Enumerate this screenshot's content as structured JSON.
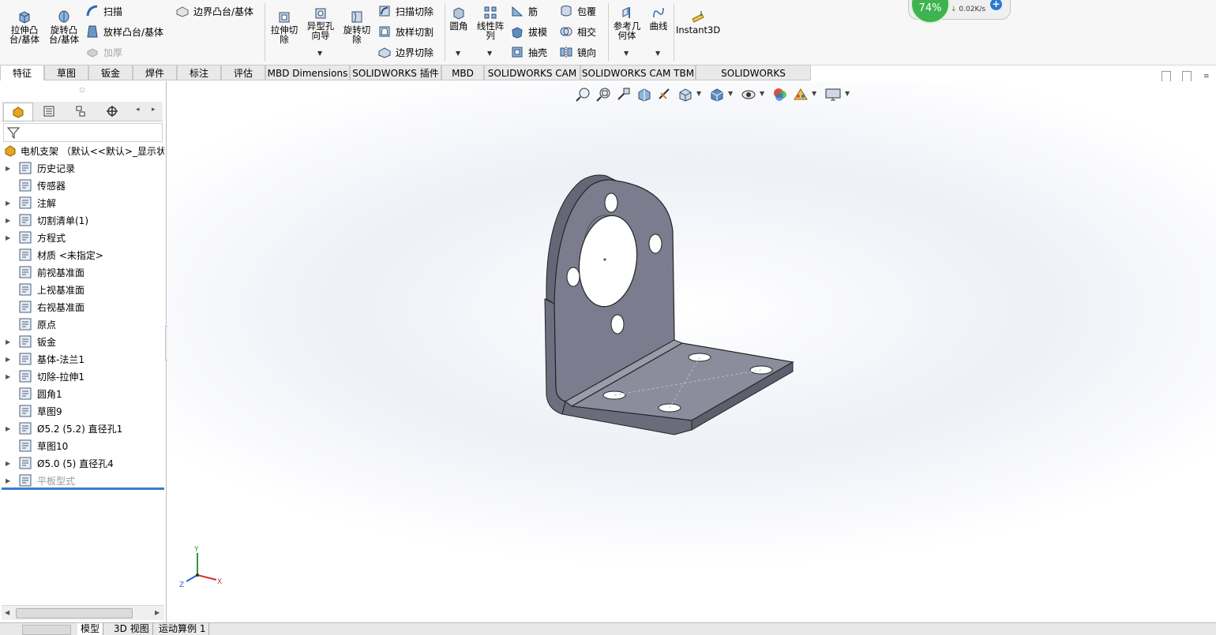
{
  "ribbon": {
    "extrude_boss": "拉伸凸\n台/基体",
    "revolve_boss": "旋转凸\n台/基体",
    "sweep": "扫描",
    "loft_boss": "放样凸台/基体",
    "thicken": "加厚",
    "boundary_boss": "边界凸台/基体",
    "extrude_cut": "拉伸切\n除",
    "hole_wizard": "异型孔\n向导",
    "revolve_cut": "旋转切\n除",
    "swept_cut": "扫描切除",
    "lofted_cut": "放样切割",
    "boundary_cut": "边界切除",
    "fillet": "圆角",
    "linear_pattern": "线性阵\n列",
    "rib": "筋",
    "draft": "拔模",
    "shell": "抽壳",
    "wrap": "包覆",
    "intersect": "相交",
    "mirror": "镜向",
    "ref_geometry": "参考几\n何体",
    "curves": "曲线",
    "instant3d": "Instant3D"
  },
  "perf_widget": {
    "percent": "74%",
    "speed": "0.02K/s"
  },
  "tabs": [
    "特征",
    "草图",
    "钣金",
    "焊件",
    "标注",
    "评估",
    "MBD Dimensions",
    "SOLIDWORKS 插件",
    "MBD",
    "SOLIDWORKS CAM",
    "SOLIDWORKS CAM TBM",
    "SOLIDWORKS Inspection"
  ],
  "tree": {
    "root": "电机支架 （默认<<默认>_显示状态",
    "items": [
      {
        "label": "历史记录",
        "expand": true,
        "icon": "history-icon"
      },
      {
        "label": "传感器",
        "expand": false,
        "icon": "sensor-icon"
      },
      {
        "label": "注解",
        "expand": true,
        "icon": "annotation-icon"
      },
      {
        "label": "切割清单(1)",
        "expand": true,
        "icon": "cut-list-icon"
      },
      {
        "label": "方程式",
        "expand": true,
        "icon": "equation-icon"
      },
      {
        "label": "材质 <未指定>",
        "expand": false,
        "icon": "material-icon"
      },
      {
        "label": "前视基准面",
        "expand": false,
        "icon": "plane-icon"
      },
      {
        "label": "上视基准面",
        "expand": false,
        "icon": "plane-icon"
      },
      {
        "label": "右视基准面",
        "expand": false,
        "icon": "plane-icon"
      },
      {
        "label": "原点",
        "expand": false,
        "icon": "origin-icon"
      },
      {
        "label": "钣金",
        "expand": true,
        "icon": "sheet-metal-icon"
      },
      {
        "label": "基体-法兰1",
        "expand": true,
        "icon": "base-flange-icon"
      },
      {
        "label": "切除-拉伸1",
        "expand": true,
        "icon": "cut-extrude-icon"
      },
      {
        "label": "圆角1",
        "expand": false,
        "icon": "fillet-icon"
      },
      {
        "label": "草图9",
        "expand": false,
        "icon": "sketch-icon"
      },
      {
        "label": "Ø5.2 (5.2) 直径孔1",
        "expand": true,
        "icon": "hole-icon"
      },
      {
        "label": "草图10",
        "expand": false,
        "icon": "sketch-icon"
      },
      {
        "label": "Ø5.0 (5) 直径孔4",
        "expand": true,
        "icon": "hole-icon"
      },
      {
        "label": "平板型式",
        "expand": true,
        "icon": "flat-pattern-icon"
      }
    ]
  },
  "triad": {
    "x": "X",
    "y": "Y",
    "z": "Z"
  },
  "bottom_tabs": [
    "模型",
    "3D 视图",
    "运动算例 1"
  ],
  "colors": {
    "part": "#7b7d8e",
    "accent": "#3a7dc9"
  }
}
